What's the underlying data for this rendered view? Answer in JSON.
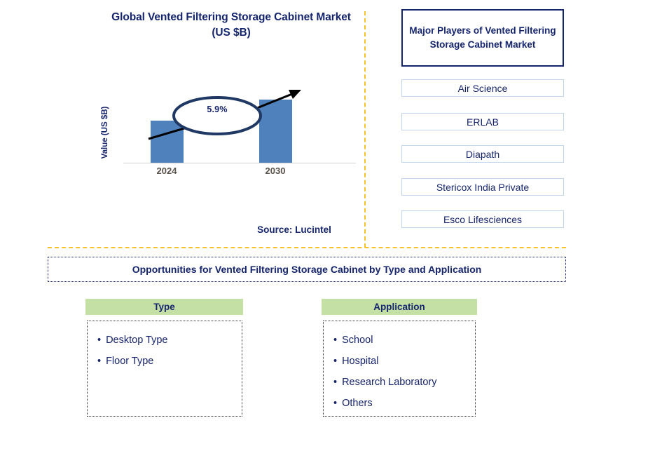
{
  "chart_panel": {
    "title": "Global Vented Filtering Storage Cabinet Market (US $B)",
    "y_axis_label": "Value (US $B)",
    "source": "Source: Lucintel"
  },
  "chart_data": {
    "type": "bar",
    "title": "Global Vented Filtering Storage Cabinet Market (US $B)",
    "categories": [
      "2024",
      "2030"
    ],
    "values": [
      60,
      90
    ],
    "xlabel": "",
    "ylabel": "Value (US $B)",
    "annotation": "5.9%",
    "annotation_meaning": "CAGR from 2024 to 2030",
    "grid": false,
    "legend": "none",
    "bar_color": "#4f81bd",
    "axis_color": "#d0d0d0",
    "tick_label_color": "#57534a"
  },
  "players_panel": {
    "header": "Major Players of Vented Filtering Storage Cabinet Market",
    "items": [
      "Air Science",
      "ERLAB",
      "Diapath",
      "Stericox India Private",
      "Esco Lifesciences"
    ]
  },
  "opportunities": {
    "banner": "Opportunities for Vented Filtering Storage Cabinet by Type and Application",
    "segments": [
      {
        "header": "Type",
        "items": [
          "Desktop Type",
          "Floor Type"
        ]
      },
      {
        "header": "Application",
        "items": [
          "School",
          "Hospital",
          "Research Laboratory",
          "Others"
        ]
      }
    ],
    "bullet": "•"
  },
  "colors": {
    "navy": "#15256d",
    "bar_blue": "#4f81bd",
    "divider_orange": "#fcc22a",
    "segment_green": "#c5e0a5",
    "player_border": "#c3d7ec"
  }
}
